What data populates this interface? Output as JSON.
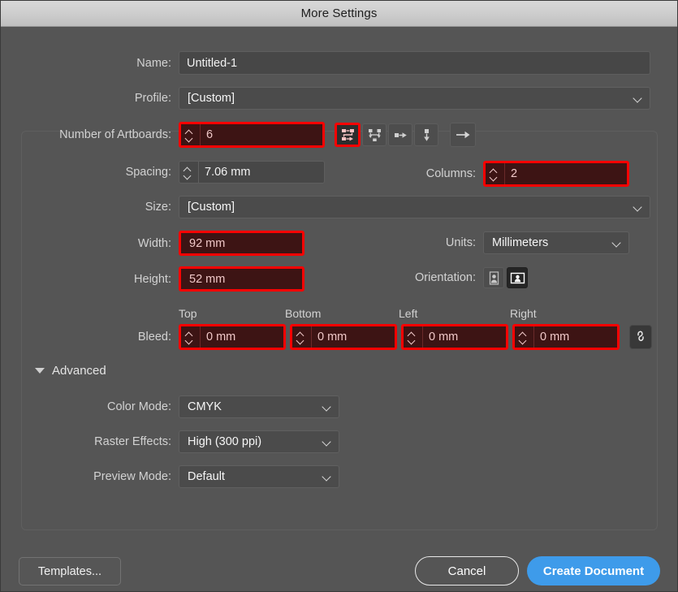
{
  "window": {
    "title": "More Settings"
  },
  "fields": {
    "name_label": "Name:",
    "name_value": "Untitled-1",
    "profile_label": "Profile:",
    "profile_value": "[Custom]",
    "artboards_label": "Number of Artboards:",
    "artboards_value": "6",
    "spacing_label": "Spacing:",
    "spacing_value": "7.06 mm",
    "columns_label": "Columns:",
    "columns_value": "2",
    "size_label": "Size:",
    "size_value": "[Custom]",
    "width_label": "Width:",
    "width_value": "92 mm",
    "height_label": "Height:",
    "height_value": "52 mm",
    "units_label": "Units:",
    "units_value": "Millimeters",
    "orientation_label": "Orientation:",
    "bleed_label": "Bleed:"
  },
  "artboard_layout_buttons": [
    {
      "name": "grid-by-row-icon",
      "title": "Grid by Row",
      "selected": true
    },
    {
      "name": "grid-by-column-icon",
      "title": "Grid by Column",
      "selected": false
    },
    {
      "name": "arrange-by-row-icon",
      "title": "Arrange by Row",
      "selected": false
    },
    {
      "name": "arrange-by-column-icon",
      "title": "Arrange by Column",
      "selected": false
    },
    {
      "name": "left-to-right-arrow-icon",
      "title": "Change to Right-to-Left Layout",
      "selected": false
    }
  ],
  "orientation": {
    "portrait_selected": false,
    "landscape_selected": true
  },
  "bleed": {
    "headers": [
      "Top",
      "Bottom",
      "Left",
      "Right"
    ],
    "values": [
      "0 mm",
      "0 mm",
      "0 mm",
      "0 mm"
    ],
    "link_icon": "link-chain-icon"
  },
  "advanced": {
    "section_label": "Advanced",
    "color_mode_label": "Color Mode:",
    "color_mode_value": "CMYK",
    "raster_label": "Raster Effects:",
    "raster_value": "High (300 ppi)",
    "preview_label": "Preview Mode:",
    "preview_value": "Default"
  },
  "footer": {
    "templates_label": "Templates...",
    "cancel_label": "Cancel",
    "create_label": "Create Document"
  },
  "colors": {
    "dialog_bg": "#555555",
    "field_bg": "#474747",
    "highlight_border": "#fc0000",
    "highlight_bg": "#3d1414",
    "highlight_text": "#f0c8c8",
    "accent_blue": "#3e9bea",
    "titlebar": "#cfcfcf"
  }
}
